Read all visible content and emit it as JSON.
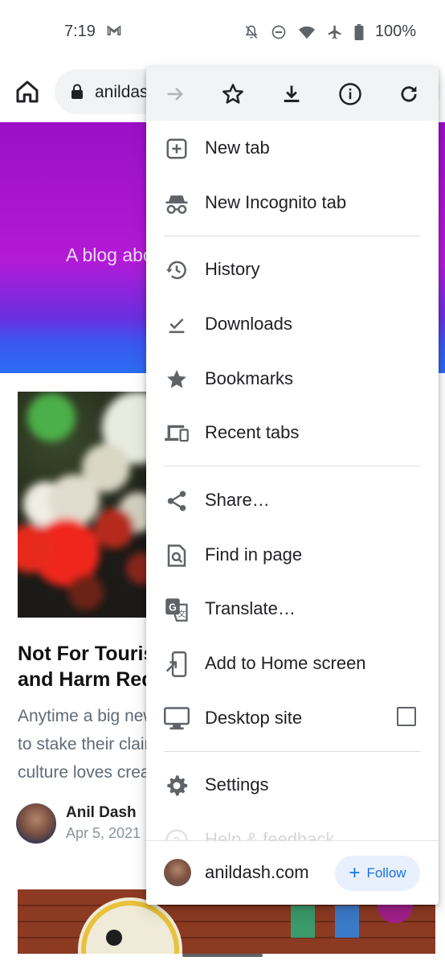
{
  "status_bar": {
    "time": "7:19",
    "battery": "100%"
  },
  "toolbar": {
    "url": "anildash.com"
  },
  "page": {
    "tagline": "A blog about",
    "article": {
      "title_lines": [
        "Not For Tourists",
        "and Harm Reduction"
      ],
      "excerpt_lines": [
        "Anytime a big new",
        "to stake their claim",
        "culture loves creating"
      ],
      "author": "Anil Dash",
      "date": "Apr 5, 2021"
    }
  },
  "menu": {
    "top_icons": [
      "forward-icon",
      "bookmark-star-icon",
      "download-icon",
      "info-icon",
      "reload-icon"
    ],
    "items": [
      {
        "label": "New tab",
        "icon": "new-tab-icon"
      },
      {
        "label": "New Incognito tab",
        "icon": "incognito-icon"
      },
      {
        "label": "History",
        "icon": "history-icon"
      },
      {
        "label": "Downloads",
        "icon": "downloads-icon"
      },
      {
        "label": "Bookmarks",
        "icon": "star-icon"
      },
      {
        "label": "Recent tabs",
        "icon": "devices-icon"
      },
      {
        "label": "Share…",
        "icon": "share-icon"
      },
      {
        "label": "Find in page",
        "icon": "find-in-page-icon"
      },
      {
        "label": "Translate…",
        "icon": "translate-icon"
      },
      {
        "label": "Add to Home screen",
        "icon": "add-to-home-icon"
      },
      {
        "label": "Desktop site",
        "icon": "desktop-icon",
        "checked": false
      },
      {
        "label": "Settings",
        "icon": "settings-icon"
      },
      {
        "label": "Help & feedback",
        "icon": "help-icon"
      }
    ],
    "footer": {
      "site": "anildash.com",
      "follow_label": "Follow"
    }
  },
  "colors": {
    "accent": "#1a73e8",
    "icon": "#5f6368",
    "follow_bg": "#e8f0fe",
    "hero": "#b31ad6"
  }
}
